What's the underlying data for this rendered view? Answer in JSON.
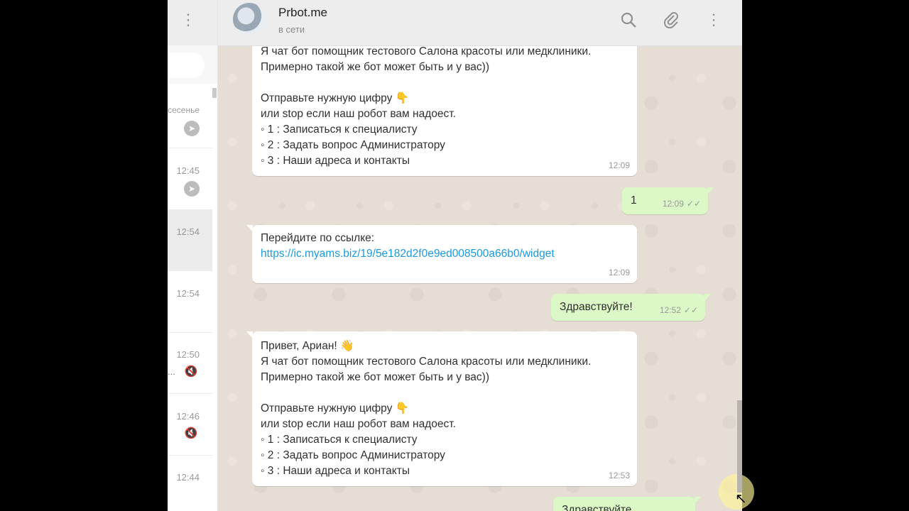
{
  "sidebar": {
    "menu_icon": "menu-dots-icon",
    "chats": [
      {
        "time": "всесенье",
        "snippet": "",
        "icon": "pin-icon"
      },
      {
        "time": "12:45",
        "snippet": "",
        "icon": "pin-icon"
      },
      {
        "time": "12:54",
        "snippet": "",
        "icon": ""
      },
      {
        "time": "12:54",
        "snippet": "",
        "icon": ""
      },
      {
        "time": "12:50",
        "snippet": "...",
        "icon": "mute-icon"
      },
      {
        "time": "12:46",
        "snippet": "",
        "icon": "mute-icon"
      },
      {
        "time": "12:44",
        "snippet": "",
        "icon": ""
      }
    ]
  },
  "header": {
    "name": "Prbot.me",
    "status": "в сети",
    "icons": [
      "search-icon",
      "paperclip-icon",
      "menu-dots-icon"
    ]
  },
  "messages": [
    {
      "dir": "in",
      "text": "Я чат бот помощник тестового Салона красоты или медклиники.\nПримерно такой же бот может быть и у вас))\n\nОтправьте нужную цифру 👇\nили stop если наш робот вам надоест.\n◦ 1 : Записаться к специалисту\n◦ 2 : Задать вопрос Администратору\n◦ 3 : Наши адреса и контакты",
      "time": "12:09"
    },
    {
      "dir": "out",
      "text": "1",
      "time": "12:09"
    },
    {
      "dir": "in",
      "text": "Перейдите по ссылке:",
      "link": "https://ic.myams.biz/19/5e182d2f0e9ed008500a66b0/widget",
      "time": "12:09"
    },
    {
      "dir": "out",
      "text": "Здравствуйте!",
      "time": "12:52"
    },
    {
      "dir": "in",
      "text": "Привет,  Ариан! 👋\nЯ чат бот помощник тестового Салона красоты или медклиники.\nПримерно такой же бот может быть и у вас))\n\nОтправьте нужную цифру 👇\nили stop если наш робот вам надоест.\n◦ 1 : Записаться к специалисту\n◦ 2 : Задать вопрос Администратору\n◦ 3 : Наши адреса и контакты",
      "time": "12:53"
    },
    {
      "dir": "out",
      "text": "Здравствуйте",
      "time": ""
    }
  ],
  "ticks": "✓✓"
}
